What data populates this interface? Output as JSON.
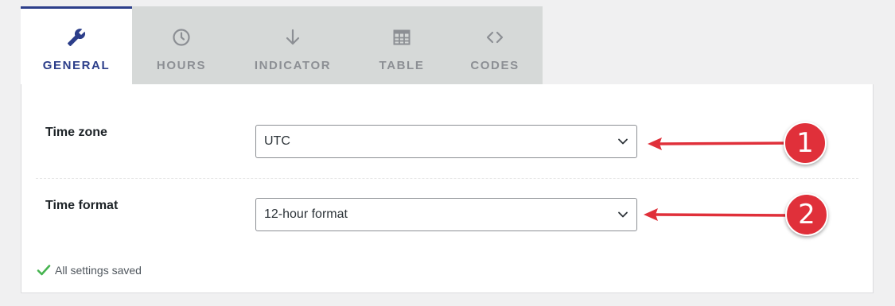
{
  "tabs": [
    {
      "label": "GENERAL",
      "icon": "wrench-icon",
      "active": true
    },
    {
      "label": "HOURS",
      "icon": "clock-icon",
      "active": false
    },
    {
      "label": "INDICATOR",
      "icon": "arrow-down-icon",
      "active": false
    },
    {
      "label": "TABLE",
      "icon": "table-icon",
      "active": false
    },
    {
      "label": "CODES",
      "icon": "code-icon",
      "active": false
    }
  ],
  "settings": {
    "time_zone": {
      "label": "Time zone",
      "value": "UTC"
    },
    "time_format": {
      "label": "Time format",
      "value": "12-hour format"
    }
  },
  "status": {
    "text": "All settings saved"
  },
  "annotations": {
    "badge_1": "1",
    "badge_2": "2"
  },
  "colors": {
    "accent": "#2c3e8a",
    "annotation_red": "#e0303a",
    "success_green": "#46b450"
  }
}
